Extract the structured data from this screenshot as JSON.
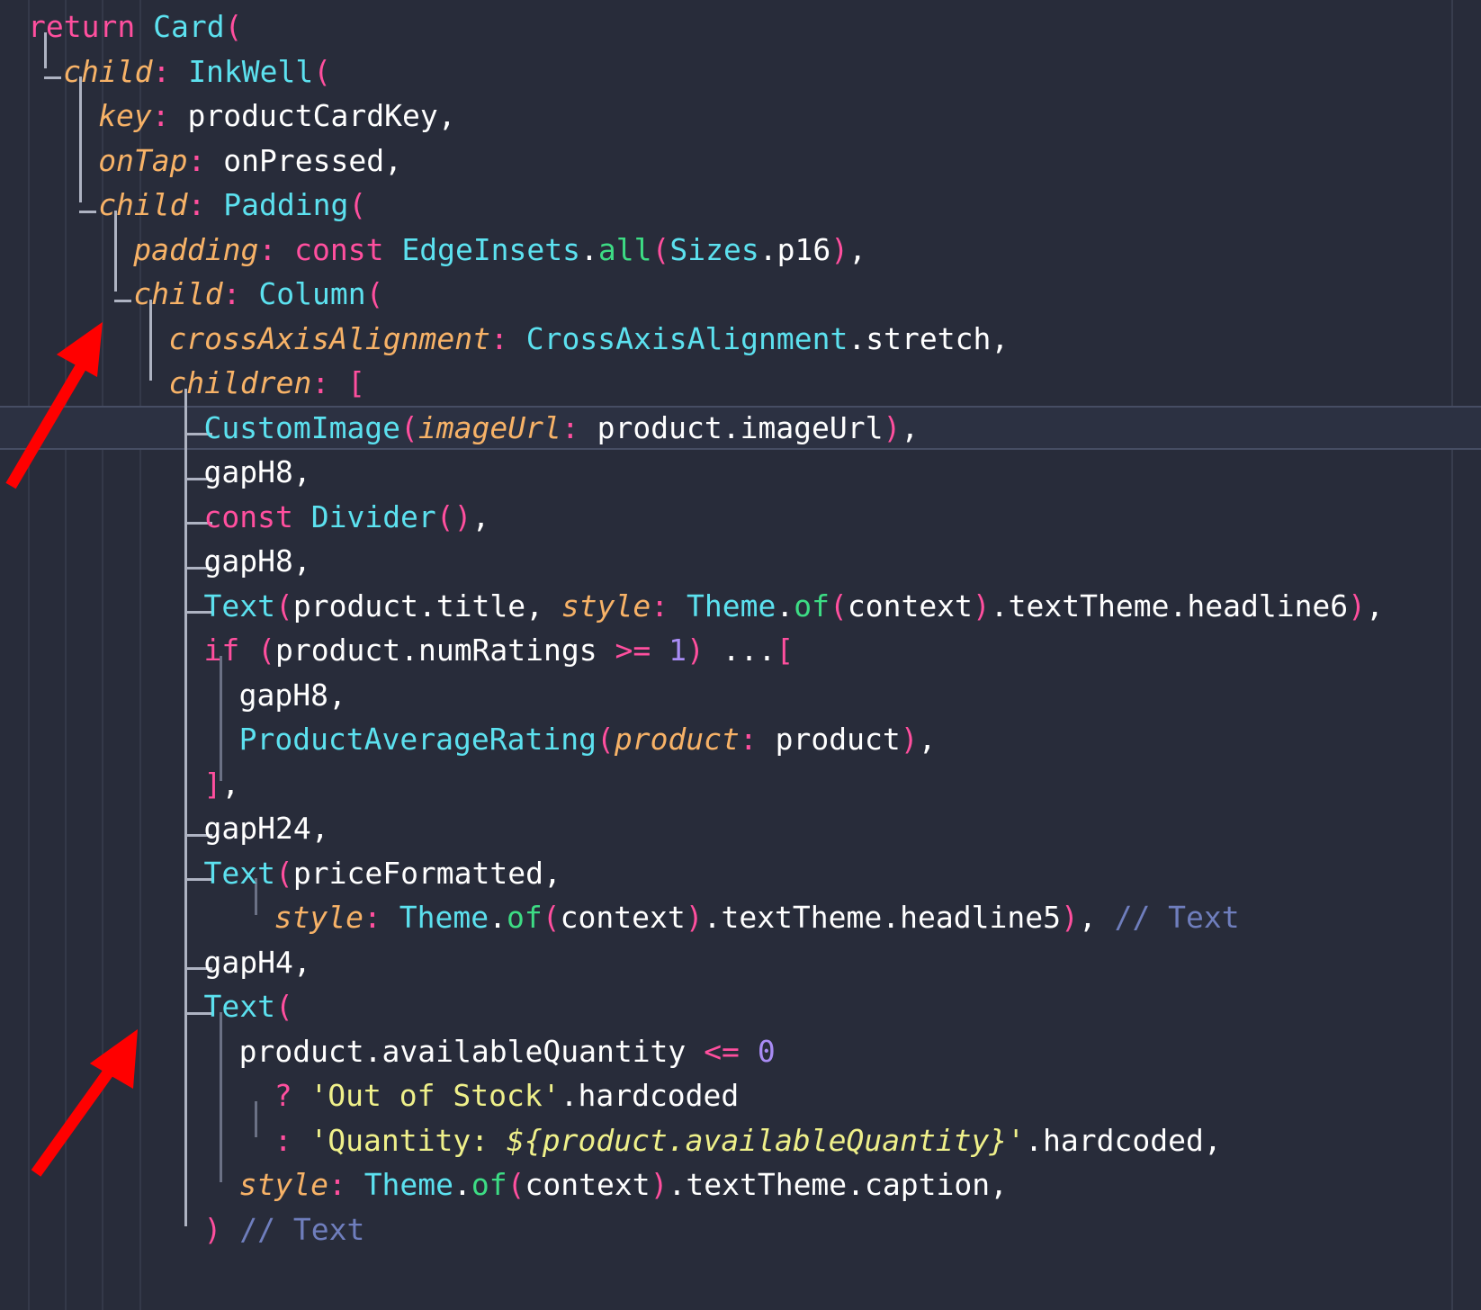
{
  "editor": {
    "app": "code-editor",
    "language": "dart",
    "theme": "dark",
    "background_color": "#282c3a",
    "current_line_index": 8,
    "colors": {
      "background": "#282c3a",
      "keyword": "#ff4f9e",
      "type": "#5ce1ef",
      "parameter": "#f7b267",
      "method": "#3ddc84",
      "number": "#a98cf5",
      "string": "#eff08a",
      "comment": "#6f7ebd",
      "text": "#ffffff",
      "guide": "#343949",
      "tree_connector": "#aeb3c2",
      "annotation_arrow": "#ff0000"
    }
  },
  "code": {
    "lines": [
      {
        "indent": 0,
        "text": "return Card("
      },
      {
        "indent": 1,
        "text": "child: InkWell("
      },
      {
        "indent": 2,
        "text": "key: productCardKey,"
      },
      {
        "indent": 2,
        "text": "onTap: onPressed,"
      },
      {
        "indent": 2,
        "text": "child: Padding("
      },
      {
        "indent": 3,
        "text": "padding: const EdgeInsets.all(Sizes.p16),"
      },
      {
        "indent": 3,
        "text": "child: Column("
      },
      {
        "indent": 4,
        "text": "crossAxisAlignment: CrossAxisAlignment.stretch,"
      },
      {
        "indent": 4,
        "text": "children: ["
      },
      {
        "indent": 5,
        "text": "CustomImage(imageUrl: product.imageUrl),"
      },
      {
        "indent": 5,
        "text": "gapH8,"
      },
      {
        "indent": 5,
        "text": "const Divider(),"
      },
      {
        "indent": 5,
        "text": "gapH8,"
      },
      {
        "indent": 5,
        "text": "Text(product.title, style: Theme.of(context).textTheme.headline6),"
      },
      {
        "indent": 5,
        "text": "if (product.numRatings >= 1) ...["
      },
      {
        "indent": 6,
        "text": "gapH8,"
      },
      {
        "indent": 6,
        "text": "ProductAverageRating(product: product),"
      },
      {
        "indent": 5,
        "text": "],"
      },
      {
        "indent": 5,
        "text": "gapH24,"
      },
      {
        "indent": 5,
        "text": "Text(priceFormatted,"
      },
      {
        "indent": 7,
        "text": "style: Theme.of(context).textTheme.headline5), // Text"
      },
      {
        "indent": 5,
        "text": "gapH4,"
      },
      {
        "indent": 5,
        "text": "Text("
      },
      {
        "indent": 6,
        "text": "product.availableQuantity <= 0"
      },
      {
        "indent": 7,
        "text": "? 'Out of Stock'.hardcoded"
      },
      {
        "indent": 7,
        "text": ": 'Quantity: ${product.availableQuantity}'.hardcoded,"
      },
      {
        "indent": 6,
        "text": "style: Theme.of(context).textTheme.caption,"
      },
      {
        "indent": 5,
        "text": ") // Text"
      }
    ]
  },
  "annotations": {
    "arrows": [
      {
        "name": "arrow-pointing-to-column-child",
        "target": "child: Column(",
        "color": "#ff0000"
      },
      {
        "name": "arrow-pointing-to-text-widget",
        "target": "Text(",
        "color": "#ff0000"
      }
    ]
  }
}
